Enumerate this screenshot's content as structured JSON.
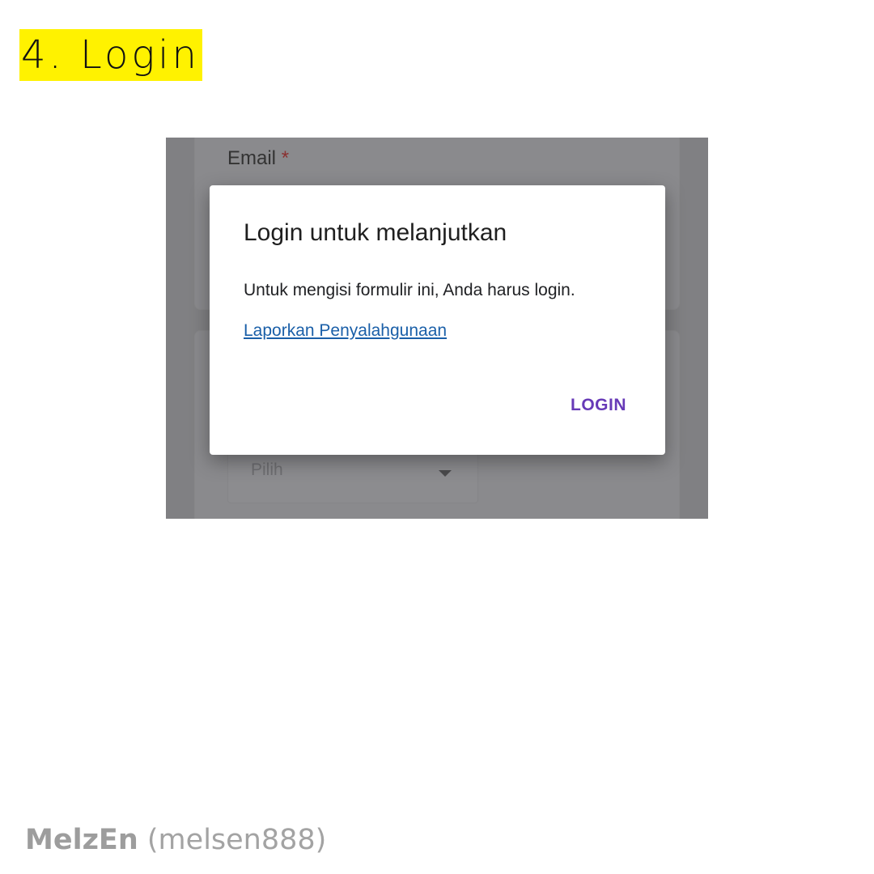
{
  "slide": {
    "title": "4. Login",
    "highlight_color": "#fff200"
  },
  "background_form": {
    "email_label": "Email",
    "required_mark": "*",
    "select_placeholder": "Pilih"
  },
  "dialog": {
    "title": "Login untuk melanjutkan",
    "message": "Untuk mengisi formulir ini, Anda harus login.",
    "report_link": "Laporkan Penyalahgunaan",
    "login_button": "LOGIN",
    "accent_color": "#673ab7"
  },
  "credit": {
    "name": "MelzEn",
    "handle": "(melsen888)"
  }
}
